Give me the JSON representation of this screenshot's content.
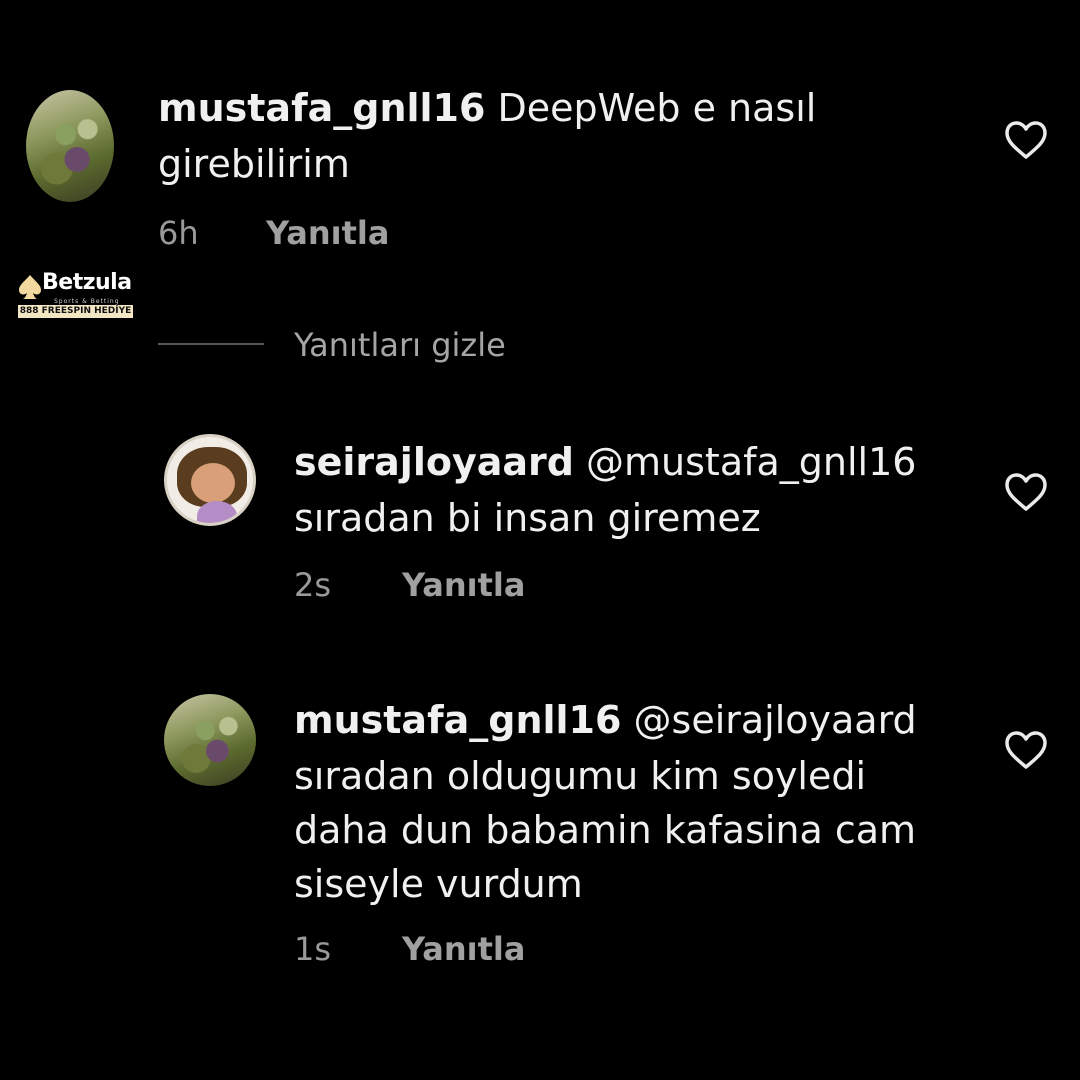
{
  "brand": {
    "name": "Betzula",
    "tagline": "Sports & Betting",
    "promo": "888 FREESPIN HEDİYE"
  },
  "comments": [
    {
      "username": "mustafa_gnll16",
      "text_line1": " DeepWeb e nasıl",
      "text_line2": "girebilirim",
      "time": "6h",
      "reply_label": "Yanıtla"
    }
  ],
  "hide_replies_label": "Yanıtları gizle",
  "replies": [
    {
      "username": "seirajloyaard",
      "mention": " @mustafa_gnll16",
      "text_line1": "sıradan bi insan giremez",
      "time": "2s",
      "reply_label": "Yanıtla"
    },
    {
      "username": "mustafa_gnll16",
      "mention": " @seirajloyaard",
      "text_line1": "sıradan oldugumu kim soyledi",
      "text_line2": "daha dun babamin kafasina cam",
      "text_line3": "siseyle vurdum",
      "time": "1s",
      "reply_label": "Yanıtla"
    }
  ],
  "colors": {
    "background": "#000000",
    "text": "#f0f0f0",
    "meta": "#9a9a9a",
    "brand_accent": "#f3e7c3"
  },
  "icons": [
    "heart-icon",
    "spade-icon"
  ]
}
